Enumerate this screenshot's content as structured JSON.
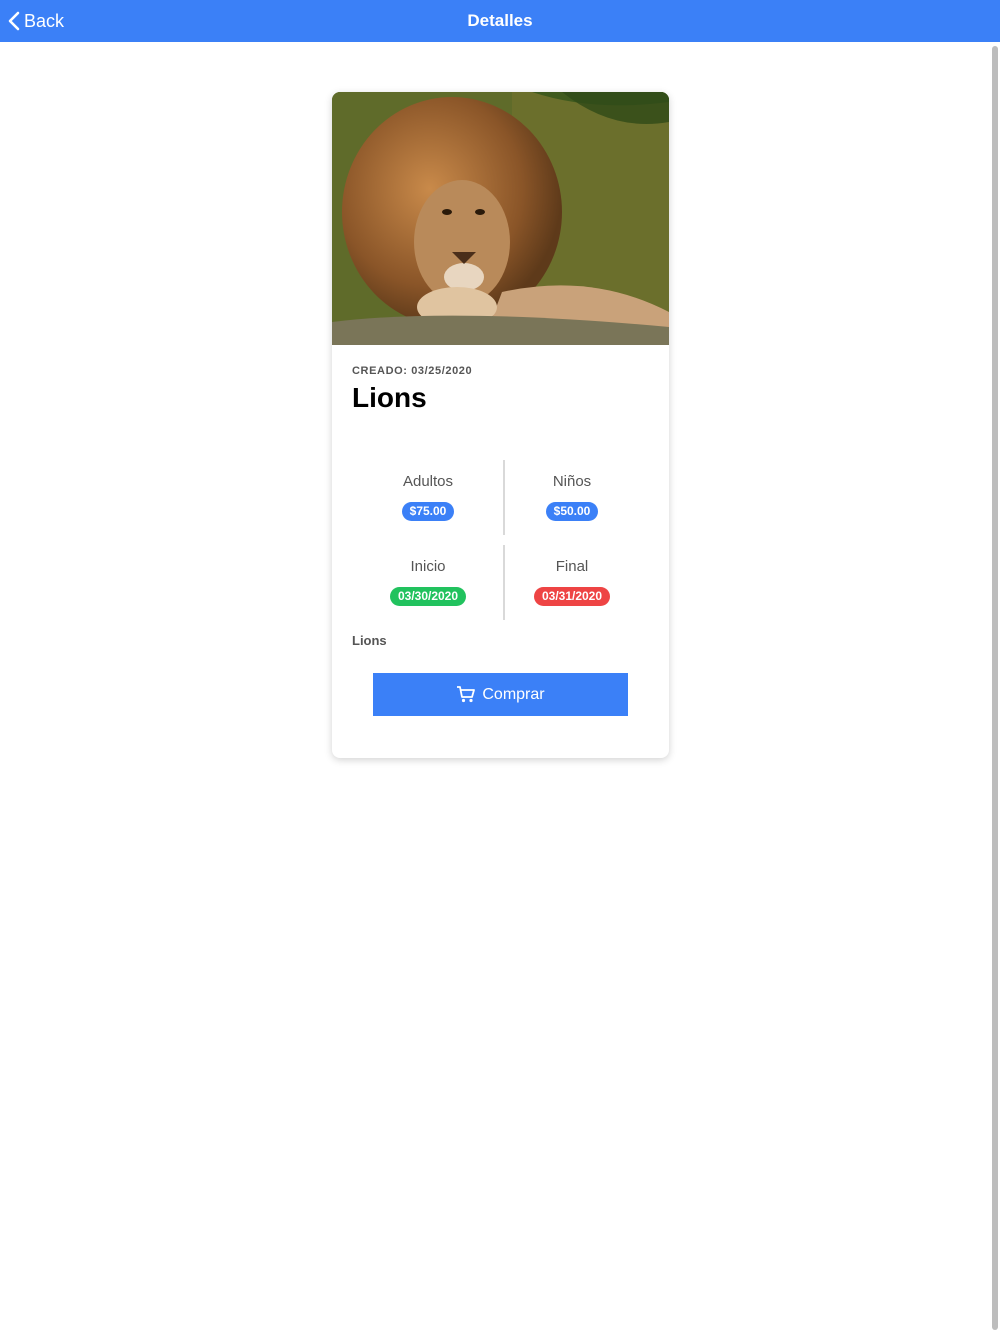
{
  "navbar": {
    "back_label": "Back",
    "title": "Detalles",
    "color": "#3b80f7"
  },
  "card": {
    "image": {
      "icon": "lion-photo"
    },
    "created": "CREADO: 03/25/2020",
    "title": "Lions",
    "prices": [
      {
        "label": "Adultos",
        "value": "$75.00",
        "color": "#3b80f7"
      },
      {
        "label": "Niños",
        "value": "$50.00",
        "color": "#3b80f7"
      }
    ],
    "dates": [
      {
        "label": "Inicio",
        "value": "03/30/2020",
        "color": "#21c25e"
      },
      {
        "label": "Final",
        "value": "03/31/2020",
        "color": "#ee4444"
      }
    ],
    "description": "Lions",
    "buy_button": {
      "label": "Comprar",
      "icon": "cart-icon"
    }
  }
}
